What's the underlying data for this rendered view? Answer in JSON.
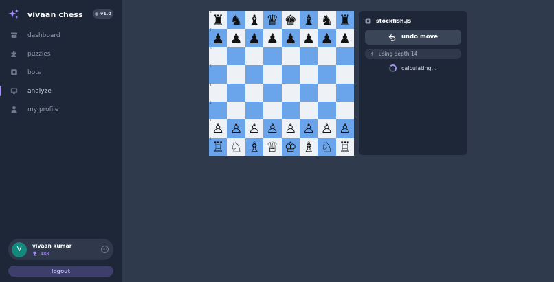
{
  "app": {
    "title": "vivaan chess",
    "version": "v1.0"
  },
  "nav": {
    "items": [
      {
        "label": "dashboard",
        "icon": "inbox-icon",
        "active": false
      },
      {
        "label": "puzzles",
        "icon": "puzzle-icon",
        "active": false
      },
      {
        "label": "bots",
        "icon": "chip-icon",
        "active": false
      },
      {
        "label": "analyze",
        "icon": "monitor-icon",
        "active": true
      },
      {
        "label": "my profile",
        "icon": "user-icon",
        "active": false
      }
    ]
  },
  "user": {
    "avatar_letter": "V",
    "name": "vivaan kumar",
    "rating": "488",
    "menu_glyph": "⋯"
  },
  "logout_label": "logout",
  "board": {
    "rows": [
      [
        "♜",
        "♞",
        "♝",
        "♛",
        "♚",
        "♝",
        "♞",
        "♜"
      ],
      [
        "♟",
        "♟",
        "♟",
        "♟",
        "♟",
        "♟",
        "♟",
        "♟"
      ],
      [
        "",
        "",
        "",
        "",
        "",
        "",
        "",
        ""
      ],
      [
        "",
        "",
        "",
        "",
        "",
        "",
        "",
        ""
      ],
      [
        "",
        "",
        "",
        "",
        "",
        "",
        "",
        ""
      ],
      [
        "",
        "",
        "",
        "",
        "",
        "",
        "",
        ""
      ],
      [
        "♙",
        "♙",
        "♙",
        "♙",
        "♙",
        "♙",
        "♙",
        "♙"
      ],
      [
        "♖",
        "♘",
        "♗",
        "♕",
        "♔",
        "♗",
        "♘",
        "♖"
      ]
    ],
    "rank_labels": [
      "8",
      "7",
      "6",
      "5",
      "4",
      "3",
      "2",
      "1"
    ]
  },
  "engine": {
    "name": "stockfish.js",
    "undo_label": "undo move",
    "depth_label": "using depth 14",
    "status": "calculating..."
  },
  "colors": {
    "accent": "#a78bfa",
    "board_light": "#eef2f6",
    "board_dark": "#6aa5ec",
    "sidebar_bg": "#1e2738",
    "page_bg": "#2f3a4c",
    "avatar_bg": "#13897d"
  }
}
